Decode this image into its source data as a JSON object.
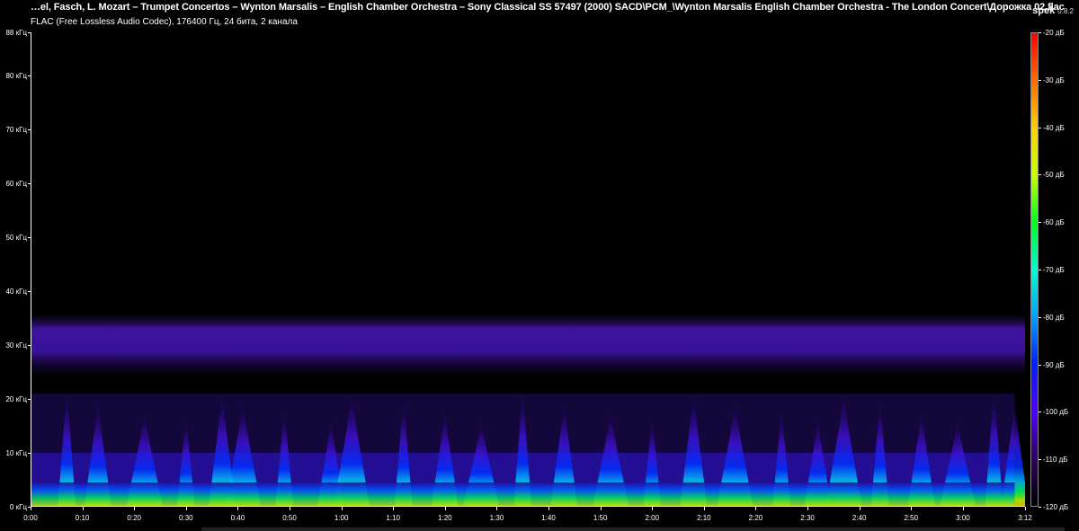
{
  "app": {
    "name": "spek",
    "version": "0.8.2"
  },
  "file": {
    "title": "…el, Fasch, L. Mozart – Trumpet Concertos – Wynton Marsalis – English Chamber Orchestra – Sony Classical SS 57497 (2000) SACD\\PCM_\\Wynton Marsalis English Chamber Orchestra - The London Concert\\Дорожка 02.flac",
    "info": "FLAC (Free Lossless Audio Codec), 176400 Гц, 24 бита, 2 канала"
  },
  "frequency_axis": {
    "labels": [
      "88 кГц",
      "80 кГц",
      "70 кГц",
      "60 кГц",
      "50 кГц",
      "40 кГц",
      "30 кГц",
      "20 кГц",
      "10 кГц",
      "0 кГц"
    ],
    "values_khz": [
      88,
      80,
      70,
      60,
      50,
      40,
      30,
      20,
      10,
      0
    ],
    "max_khz": 88
  },
  "time_axis": {
    "labels": [
      "0:00",
      "0:10",
      "0:20",
      "0:30",
      "0:40",
      "0:50",
      "1:00",
      "1:10",
      "1:20",
      "1:30",
      "1:40",
      "1:50",
      "2:00",
      "2:10",
      "2:20",
      "2:30",
      "2:40",
      "2:50",
      "3:00",
      "3:12"
    ],
    "values_sec": [
      0,
      10,
      20,
      30,
      40,
      50,
      60,
      70,
      80,
      90,
      100,
      110,
      120,
      130,
      140,
      150,
      160,
      170,
      180,
      192
    ],
    "duration_sec": 192
  },
  "db_scale": {
    "labels": [
      "-20 дБ",
      "-30 дБ",
      "-40 дБ",
      "-50 дБ",
      "-60 дБ",
      "-70 дБ",
      "-80 дБ",
      "-90 дБ",
      "-100 дБ",
      "-110 дБ",
      "-120 дБ"
    ],
    "values_db": [
      -20,
      -30,
      -40,
      -50,
      -60,
      -70,
      -80,
      -90,
      -100,
      -110,
      -120
    ],
    "colors": [
      "#ff0000",
      "#ff6a00",
      "#ffd000",
      "#c8ff00",
      "#00ff20",
      "#00ffd0",
      "#00a0ff",
      "#0020ff",
      "#5000ff",
      "#300060",
      "#000000"
    ]
  },
  "spectrogram": {
    "noise_band_khz": [
      25,
      35
    ],
    "noise_color": "#3a10a0",
    "music_cutoff_khz": 21,
    "music_bursts_sec": [
      7,
      13,
      22,
      30,
      37,
      41,
      49,
      58,
      62,
      72,
      80,
      87,
      95,
      103,
      112,
      120,
      128,
      136,
      145,
      152,
      157,
      164,
      172,
      179,
      186,
      190
    ]
  }
}
